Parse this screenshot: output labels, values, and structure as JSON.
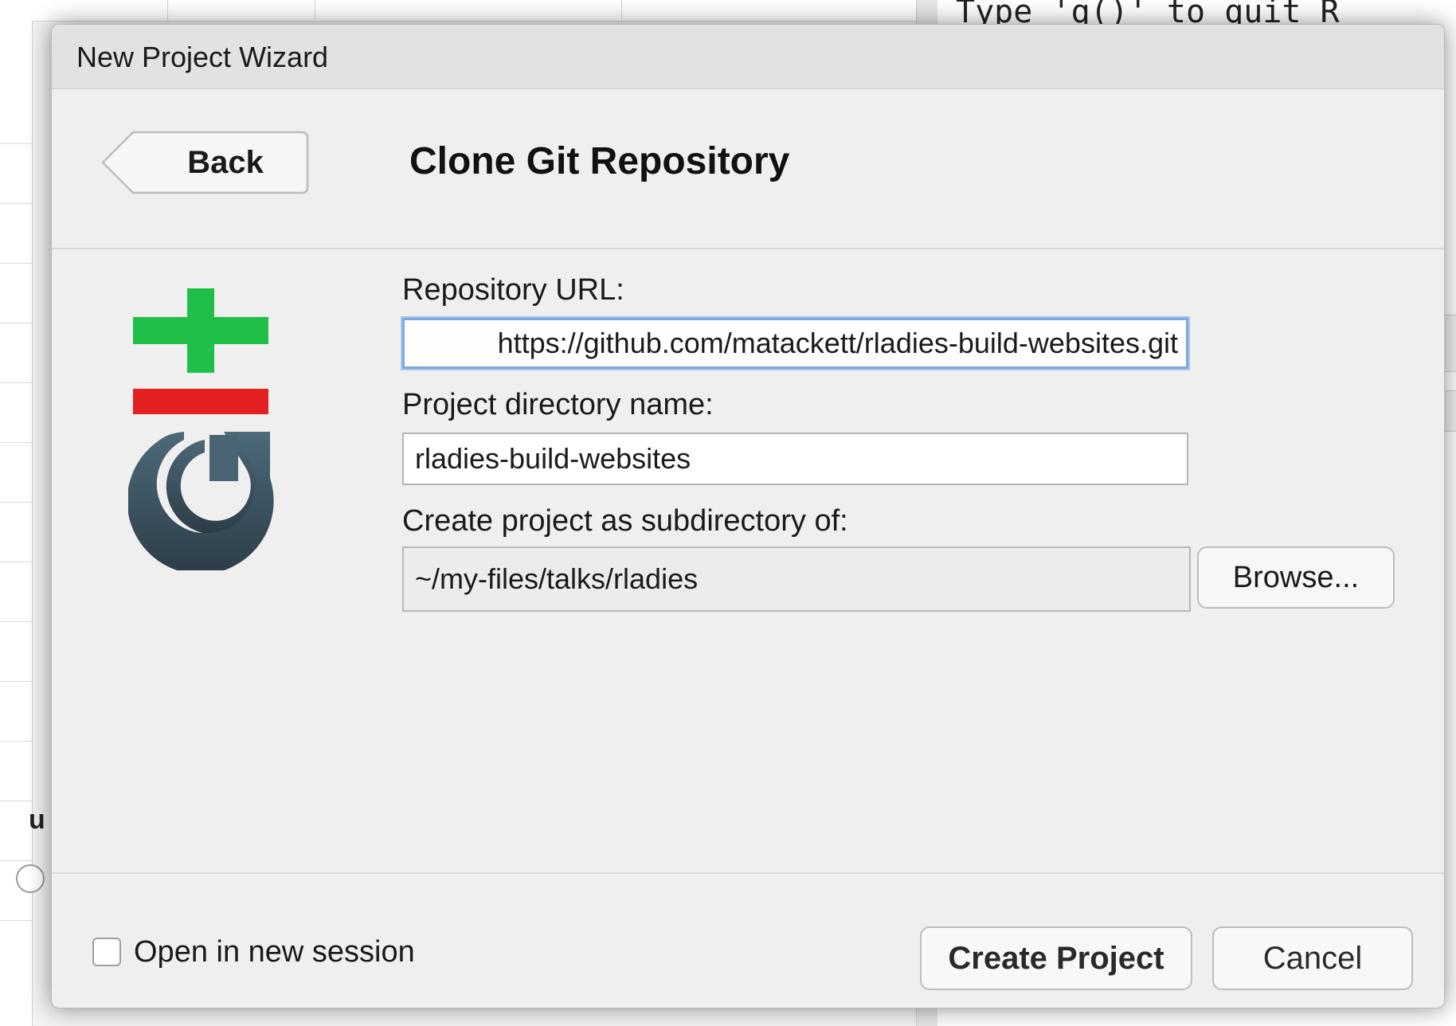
{
  "background": {
    "console_text": "Type 'q()' to quit R",
    "left_panel_label": "u",
    "left_panel_circle_symbol": "-"
  },
  "dialog": {
    "title": "New Project Wizard",
    "back_label": "Back",
    "heading": "Clone Git Repository",
    "logo_icon": "git-logo-icon",
    "fields": {
      "repo_url": {
        "label": "Repository URL:",
        "value": "https://github.com/matackett/rladies-build-websites.git"
      },
      "project_dir": {
        "label": "Project directory name:",
        "value": "rladies-build-websites"
      },
      "subdirectory": {
        "label": "Create project as subdirectory of:",
        "value": "~/my-files/talks/rladies"
      }
    },
    "browse_label": "Browse...",
    "open_new_session_label": "Open in new session",
    "open_new_session_checked": false,
    "create_label": "Create Project",
    "cancel_label": "Cancel"
  },
  "colors": {
    "focus_ring": "#7fa8e3",
    "git_plus_green": "#1fbf4a",
    "git_minus_red": "#e32020",
    "git_arrow_slate": "#3e5766"
  }
}
